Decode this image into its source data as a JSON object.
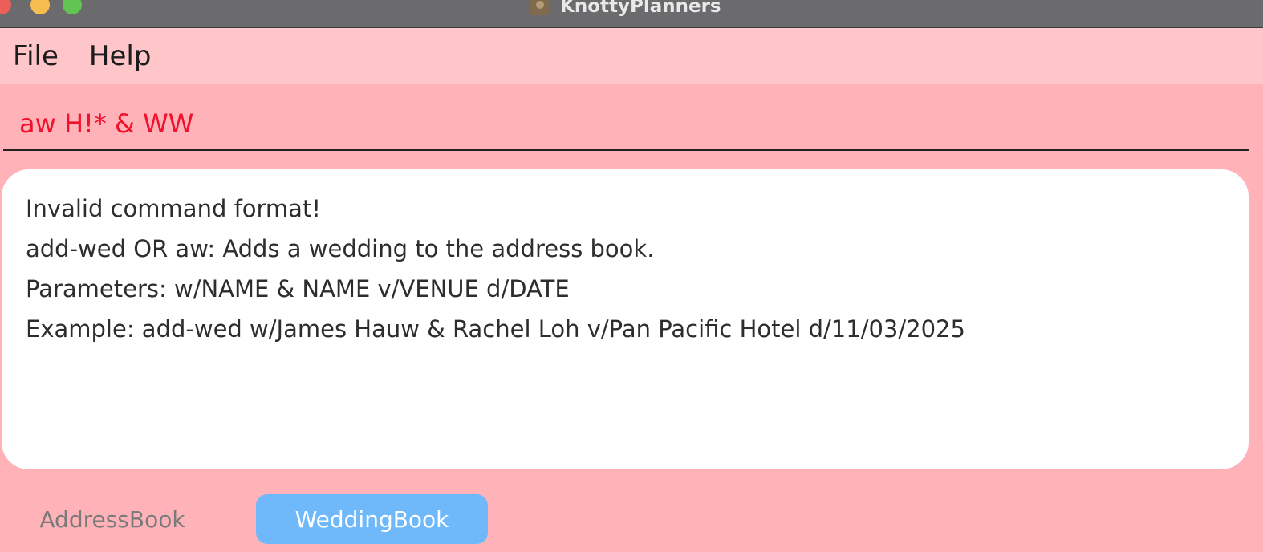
{
  "window": {
    "title": "KnottyPlanners"
  },
  "menu": {
    "file": "File",
    "help": "Help"
  },
  "command": {
    "value": "aw H!* & WW",
    "color_error": "#f0112c"
  },
  "result": {
    "lines": [
      "Invalid command format!",
      "add-wed OR aw: Adds a wedding to the address book.",
      "Parameters: w/NAME & NAME v/VENUE d/DATE",
      "Example: add-wed w/James Hauw & Rachel Loh v/Pan Pacific Hotel d/11/03/2025"
    ]
  },
  "tabs": {
    "items": [
      {
        "label": "AddressBook",
        "selected": false
      },
      {
        "label": "WeddingBook",
        "selected": true
      }
    ]
  },
  "colors": {
    "background": "#ffb3b8",
    "menubar": "#ffc6ca",
    "accent": "#6fb9fb"
  },
  "icons": {
    "app": "app-icon",
    "close": "close-icon",
    "minimize": "minimize-icon",
    "maximize": "maximize-icon"
  }
}
